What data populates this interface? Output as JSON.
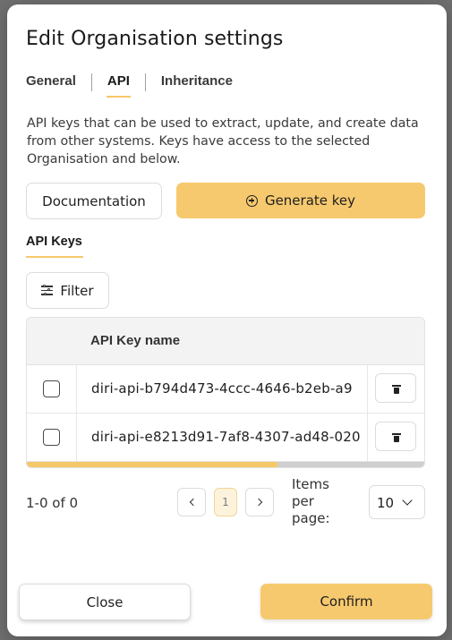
{
  "dialog": {
    "title": "Edit Organisation settings",
    "tabs": [
      {
        "label": "General",
        "active": false
      },
      {
        "label": "API",
        "active": true
      },
      {
        "label": "Inheritance",
        "active": false
      }
    ],
    "description": "API keys that can be used to extract, update, and create data from other systems. Keys have access to the selected Organisation and below."
  },
  "actions": {
    "documentation_label": "Documentation",
    "generate_label": "Generate key",
    "generate_icon": "plus-circle-icon"
  },
  "keys_section": {
    "label": "API Keys",
    "filter_label": "Filter",
    "filter_icon": "sliders-icon"
  },
  "table": {
    "columns": [
      "",
      "API Key name",
      ""
    ],
    "rows": [
      {
        "name": "diri-api-b794d473-4ccc-4646-b2eb-a9",
        "checked": false,
        "delete_icon": "trash-icon"
      },
      {
        "name": "diri-api-e8213d91-7af8-4307-ad48-020",
        "checked": false,
        "delete_icon": "trash-icon"
      }
    ],
    "scroll_position": 0.63
  },
  "pagination": {
    "range_text": "1-0 of 0",
    "current_page": "1",
    "items_per_page_label": "Items per page:",
    "items_per_page_value": "10"
  },
  "footer": {
    "close_label": "Close",
    "confirm_label": "Confirm"
  },
  "colors": {
    "accent": "#f7c96e",
    "backdrop": "#6f6f6f"
  }
}
